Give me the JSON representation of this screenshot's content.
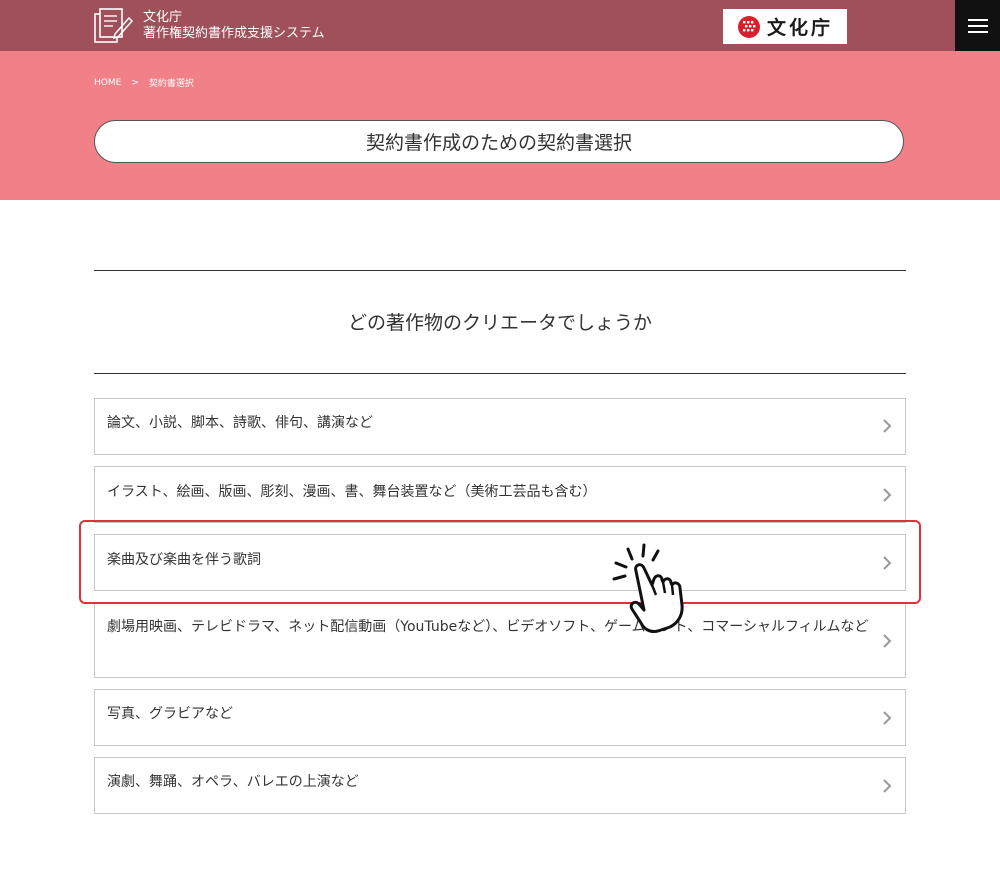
{
  "header": {
    "brand_line1": "文化庁",
    "brand_line2": "著作権契約書作成支援システム",
    "logo_text": "文化庁",
    "menu_icon": "hamburger-icon"
  },
  "breadcrumb": {
    "home": "HOME",
    "separator": ">",
    "current": "契約書選択"
  },
  "page_title": "契約書作成のための契約書選択",
  "question": "どの著作物のクリエータでしょうか",
  "options": [
    {
      "label": "論文、小説、脚本、詩歌、俳句、講演など"
    },
    {
      "label": "イラスト、絵画、版画、彫刻、漫画、書、舞台装置など（美術工芸品も含む）"
    },
    {
      "label": "楽曲及び楽曲を伴う歌詞"
    },
    {
      "label": "劇場用映画、テレビドラマ、ネット配信動画（YouTubeなど）、ビデオソフト、ゲームソフト、コマーシャルフィルムなど"
    },
    {
      "label": "写真、グラビアなど"
    },
    {
      "label": "演劇、舞踊、オペラ、バレエの上演など"
    }
  ],
  "colors": {
    "header_bg": "#a0505a",
    "hero_bg": "#f28088",
    "highlight": "#e0323c"
  }
}
